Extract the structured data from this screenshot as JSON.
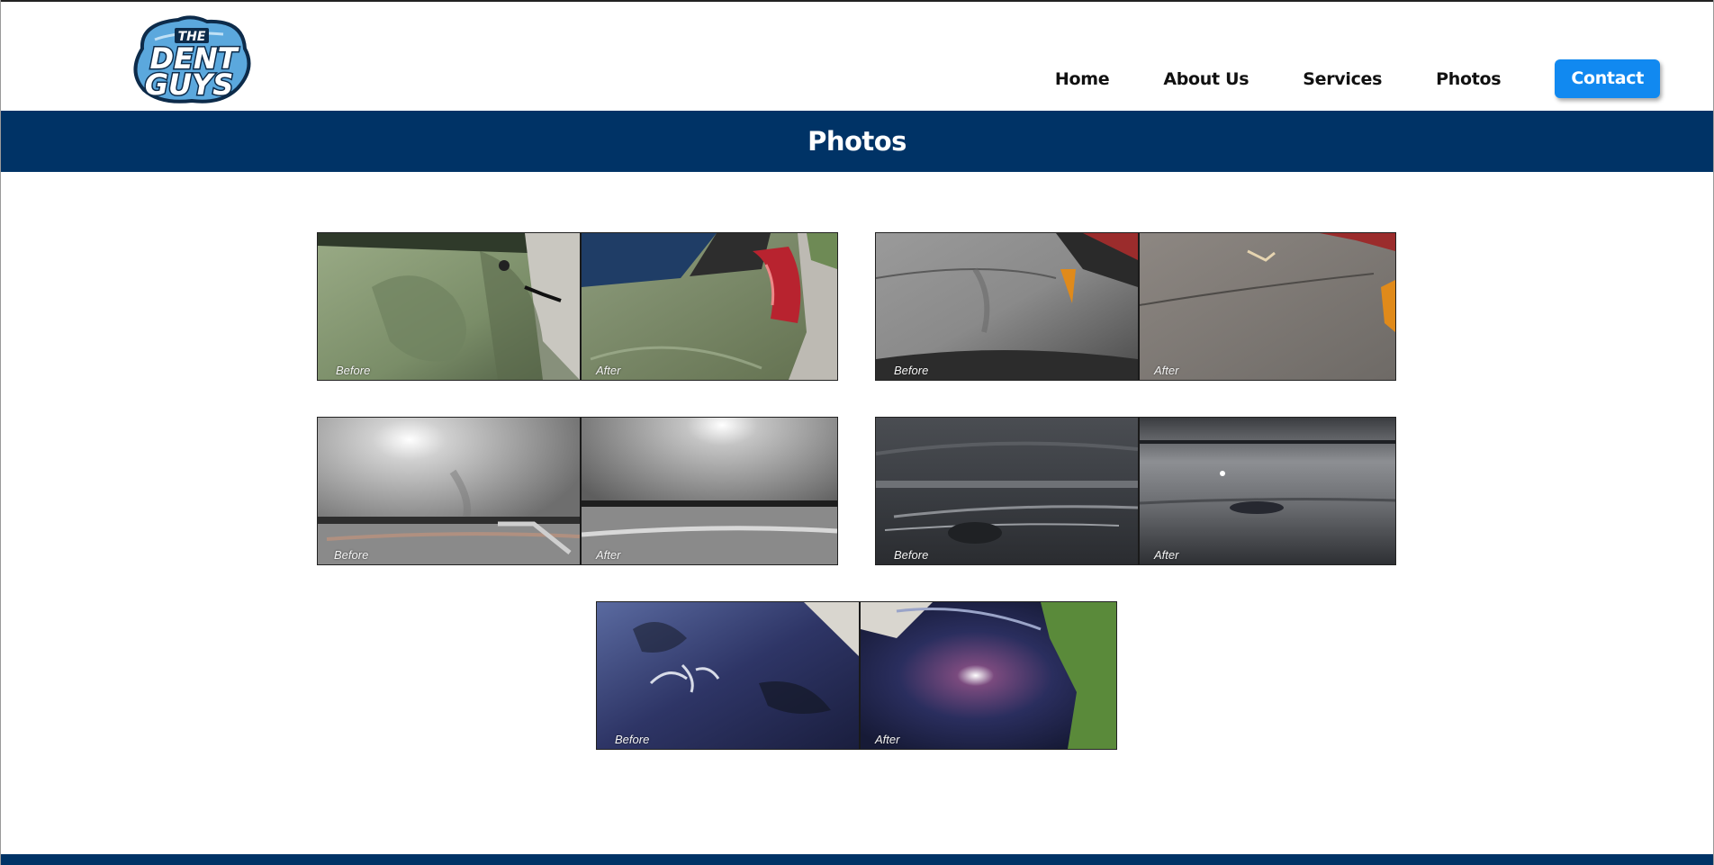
{
  "brand": {
    "logo_text_line1": "THE",
    "logo_text_line2": "DENT",
    "logo_text_line3": "GUYS",
    "colors": {
      "navy": "#003366",
      "accent_blue": "#1189f0",
      "logo_sky": "#5ba8dd"
    }
  },
  "nav": {
    "items": [
      {
        "label": "Home"
      },
      {
        "label": "About Us"
      },
      {
        "label": "Services"
      },
      {
        "label": "Photos"
      }
    ],
    "contact_label": "Contact"
  },
  "banner": {
    "title": "Photos"
  },
  "gallery": [
    {
      "before_caption": "Before",
      "after_caption": "After",
      "subject": "green quarter panel"
    },
    {
      "before_caption": "Before",
      "after_caption": "After",
      "subject": "grey fender"
    },
    {
      "before_caption": "Before",
      "after_caption": "After",
      "subject": "silver door"
    },
    {
      "before_caption": "Before",
      "after_caption": "After",
      "subject": "dark grey side"
    },
    {
      "before_caption": "Before",
      "after_caption": "After",
      "subject": "blue roof"
    }
  ]
}
